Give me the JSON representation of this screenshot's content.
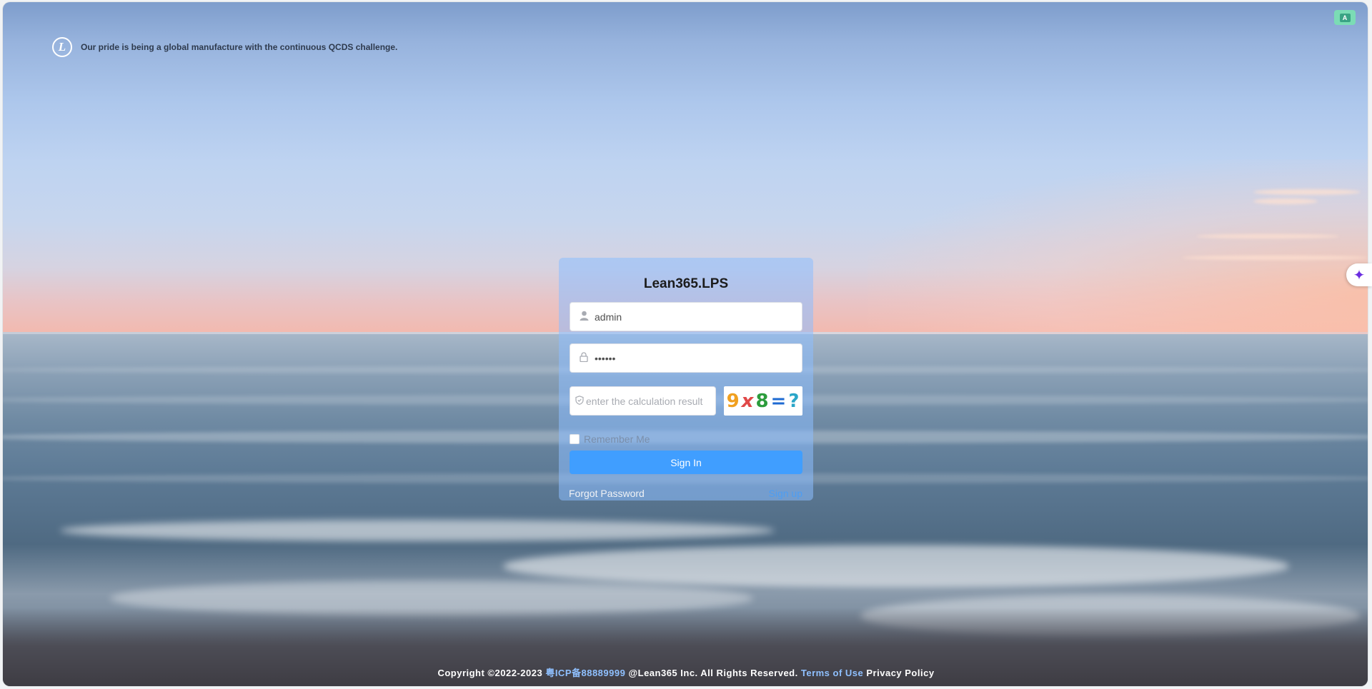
{
  "brand": {
    "slogan": "Our pride is being a global manufacture with the continuous QCDS challenge.",
    "logo_glyph": "L"
  },
  "translate_widget": {
    "glyph": "A"
  },
  "assistant": {
    "glyph": "✦"
  },
  "login": {
    "title": "Lean365.LPS",
    "username": {
      "value": "admin",
      "icon": "user-icon"
    },
    "password": {
      "value": "••••••",
      "icon": "lock-icon"
    },
    "captcha": {
      "placeholder": "enter the calculation result",
      "icon": "shield-icon",
      "image_text": [
        "9",
        "x",
        "8",
        "=",
        "?"
      ],
      "image_colors": [
        "#f0a020",
        "#e04848",
        "#2c9c3c",
        "#1e6ad2",
        "#2aa6c8"
      ]
    },
    "remember_label": "Remember Me",
    "signin_label": "Sign In",
    "forgot_label": "Forgot Password",
    "signup_label": "Sign up"
  },
  "footer": {
    "copyright": "Copyright ©2022-2023",
    "icp": "粤ICP备88889999",
    "company": "@Lean365 Inc. All Rights Reserved.",
    "terms": "Terms of Use",
    "privacy": "Privacy Policy"
  },
  "colors": {
    "primary": "#409eff",
    "card_bg": "rgba(140,190,255,0.55)",
    "translate_widget": "#7bdcb5",
    "assistant_icon": "#6b2de0"
  }
}
